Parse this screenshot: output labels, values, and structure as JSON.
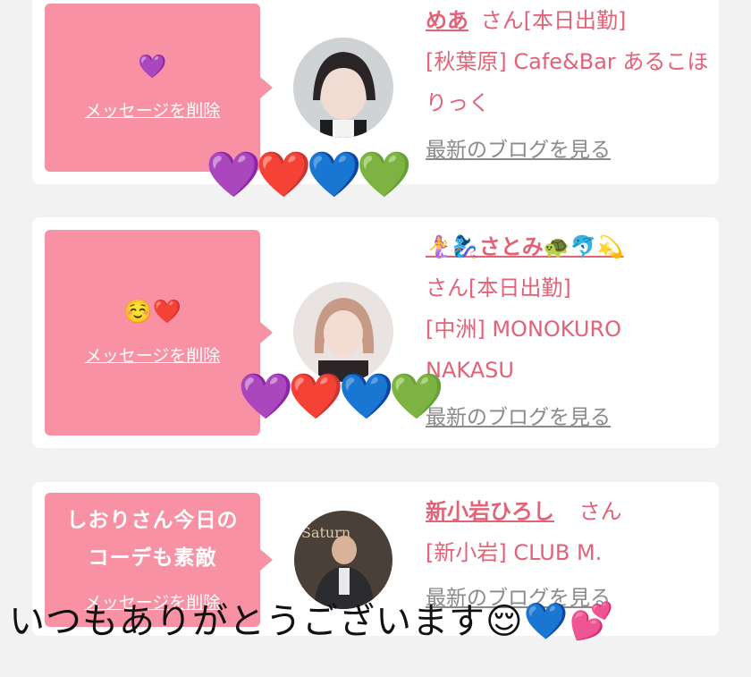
{
  "cards": [
    {
      "message": "💜",
      "delete_label": "メッセージを削除",
      "name": "めあ",
      "suffix": "さん[本日出勤]",
      "shop": "[秋葉原] Cafe&Bar あるこほりっく",
      "blog_label": "最新のブログを見る"
    },
    {
      "message": "☺️❤️",
      "delete_label": "メッセージを削除",
      "name": "🧜‍♀️🧞‍♀️さとみ🐢🐬💫",
      "suffix": "さん[本日出勤]",
      "shop": "[中洲] MONOKURO NAKASU",
      "blog_label": "最新のブログを見る"
    },
    {
      "message": "しおりさん今日のコーデも素敵",
      "delete_label": "メッセージを削除",
      "name": "新小岩ひろし",
      "suffix": "さん",
      "shop": "[新小岩] CLUB M.",
      "blog_label": "最新のブログを見る"
    }
  ],
  "overlays": {
    "hearts_row": "💜❤️💙💚",
    "caption": "いつもありがとうございます😌💙💕"
  },
  "colors": {
    "bubble": "#f791a3",
    "accent_text": "#e26277",
    "background": "#f2f2f2"
  }
}
